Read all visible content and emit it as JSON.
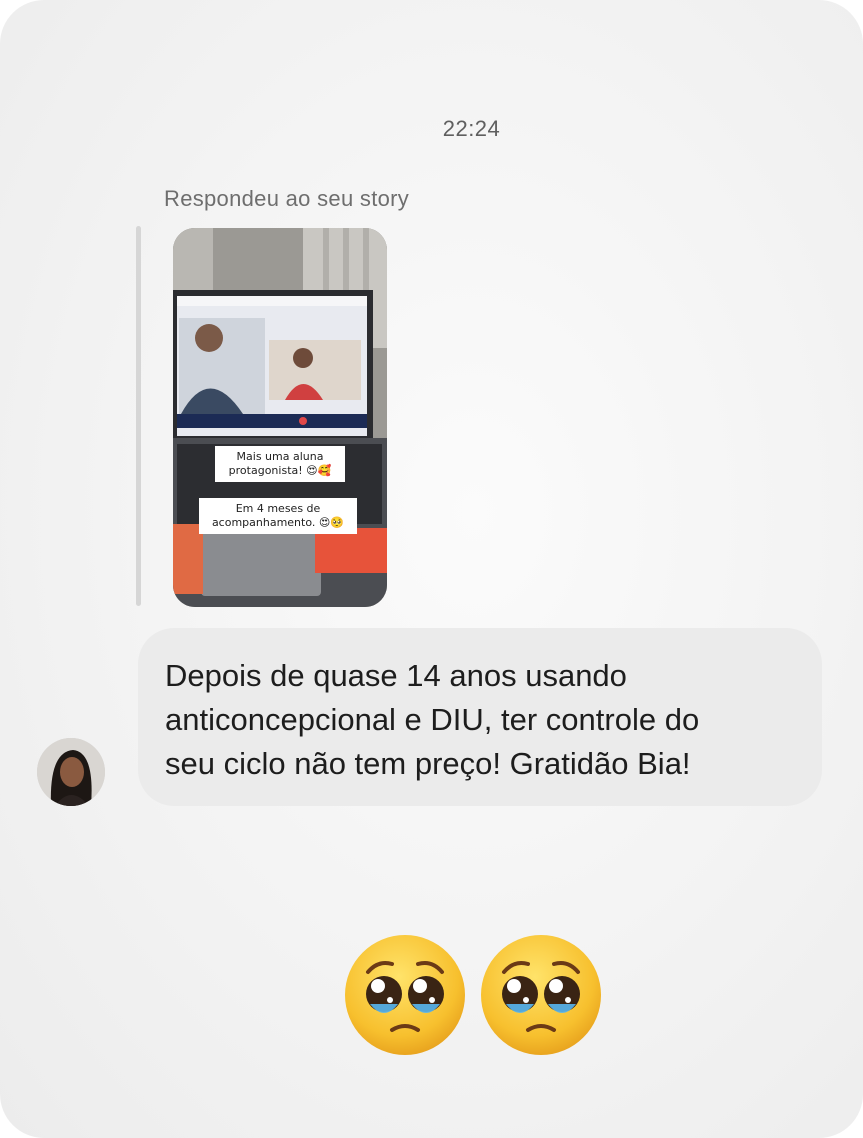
{
  "thread": {
    "timestamp": "22:24",
    "reply_caption": "Respondeu ao seu story"
  },
  "story": {
    "overlay_line_1": "Mais uma aluna\nprotagonista! 😍🥰",
    "overlay_line_2": "Em 4 meses de\nacompanhamento. 😍🥺"
  },
  "message": {
    "text": "Depois de quase 14 anos usando\nanticoncepcional e DIU, ter controle  do\nseu ciclo não tem preço! Gratidão Bia!"
  },
  "reaction": {
    "emojis": [
      "pleading-face",
      "pleading-face"
    ]
  }
}
